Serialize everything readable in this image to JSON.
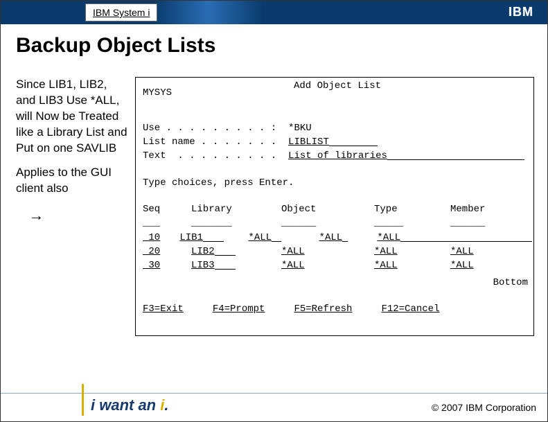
{
  "header": {
    "tab_label": "IBM System i",
    "logo_text": "IBM"
  },
  "title": "Backup Object Lists",
  "sidebar": {
    "block1": "Since LIB1, LIB2, and LIB3 Use *ALL, will Now be Treated like a Library List and Put on one SAVLIB",
    "block2": "Applies to the GUI client also",
    "arrow": "→"
  },
  "terminal": {
    "title": "Add Object List",
    "system": "MYSYS",
    "fields": {
      "use_label": "Use . . . . . . . . . :  ",
      "use_value": "*BKU",
      "listname_label": "List name . . . . . . .  ",
      "listname_value": "LIBLIST",
      "text_label": "Text  . . . . . . . . .  ",
      "text_value": "List of libraries"
    },
    "choices": "Type choices, press Enter.",
    "columns": {
      "seq": "Seq",
      "library": "Library",
      "object": "Object",
      "type": "Type",
      "member": "Member"
    },
    "dashes": {
      "seq": "___",
      "library": "_______",
      "object": "______",
      "type": "_____",
      "member": "______"
    },
    "rows": [
      {
        "seq": " 10",
        "library": "LIB1",
        "object": "*ALL",
        "type": "*ALL",
        "member": "*ALL"
      },
      {
        "seq": " 20",
        "library": "LIB2",
        "object": "*ALL",
        "type": "*ALL",
        "member": "*ALL"
      },
      {
        "seq": " 30",
        "library": "LIB3",
        "object": "*ALL",
        "type": "*ALL",
        "member": "*ALL"
      }
    ],
    "bottom": "Bottom",
    "fkeys": {
      "f3": "F3=Exit",
      "f4": "F4=Prompt",
      "f5": "F5=Refresh",
      "f12": "F12=Cancel"
    }
  },
  "footer": {
    "slogan_prefix": "i want an ",
    "slogan_i": "i",
    "slogan_suffix": ".",
    "copyright": "© 2007 IBM Corporation"
  }
}
